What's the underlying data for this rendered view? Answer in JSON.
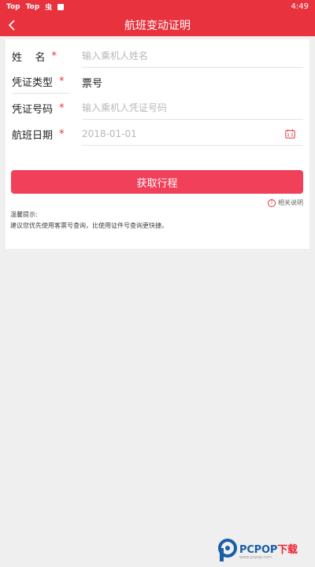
{
  "statusbar": {
    "left_items": [
      "Top",
      "Top",
      "虫"
    ],
    "time": "4:49"
  },
  "navbar": {
    "title": "航班变动证明"
  },
  "form": {
    "name": {
      "label": "姓    名",
      "required": "*",
      "placeholder": "输入乘机人姓名"
    },
    "doc_type": {
      "label": "凭证类型",
      "required": "*",
      "value": "票号"
    },
    "doc_number": {
      "label": "凭证号码",
      "required": "*",
      "placeholder": "输入乘机人凭证号码"
    },
    "flight_date": {
      "label": "航班日期",
      "required": "*",
      "placeholder": "2018-01-01"
    }
  },
  "actions": {
    "get_itinerary": "获取行程",
    "help": "相关说明",
    "help_icon_glyph": "?"
  },
  "tips": {
    "title": "温馨提示:",
    "text": "建议您优先使用客票号查询，比使用证件号查询更快捷。"
  },
  "watermark": {
    "brand_part1": "PCPOP",
    "brand_part2": "下载",
    "subtitle": "www.pcpop.com"
  },
  "colors": {
    "primary": "#e8333e",
    "button": "#f0405a",
    "background": "#efefef"
  },
  "icons": {
    "back": "back-arrow-icon",
    "calendar": "calendar-icon",
    "help": "help-circle-icon",
    "logo": "pcpop-logo-icon"
  }
}
